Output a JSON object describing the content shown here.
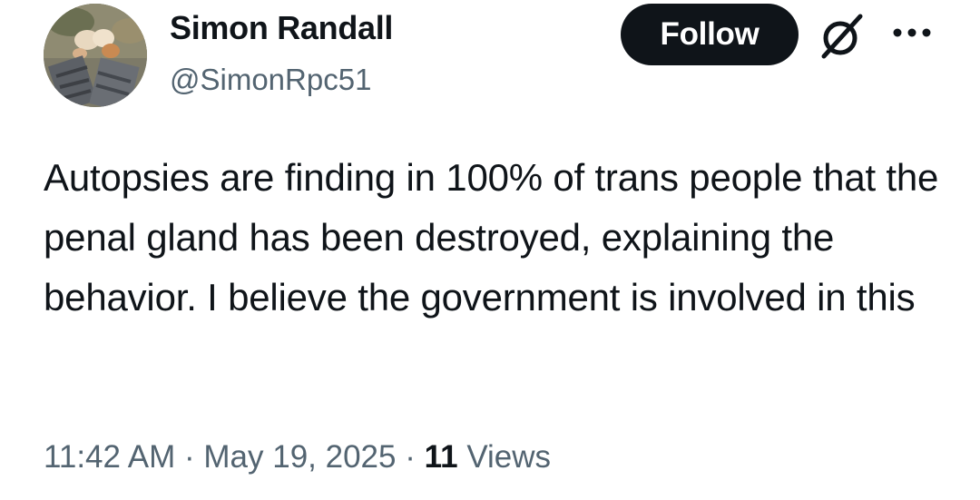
{
  "author": {
    "display_name": "Simon Randall",
    "handle": "@SimonRpc51"
  },
  "actions": {
    "follow_label": "Follow",
    "grok_icon": "grok-slash-circle-icon",
    "more_icon": "more-horizontal-icon"
  },
  "tweet": {
    "text": "Autopsies are finding in 100% of trans people that the penal gland has been destroyed, explaining the behavior. I believe the government is involved in this"
  },
  "meta": {
    "time": "11:42 AM",
    "separator1": " · ",
    "date": "May 19, 2025",
    "separator2": " · ",
    "views_count": "11",
    "views_label": " Views"
  },
  "colors": {
    "primary_text": "#0f1419",
    "secondary_text": "#536471",
    "button_bg": "#0f1419",
    "button_text": "#ffffff"
  }
}
